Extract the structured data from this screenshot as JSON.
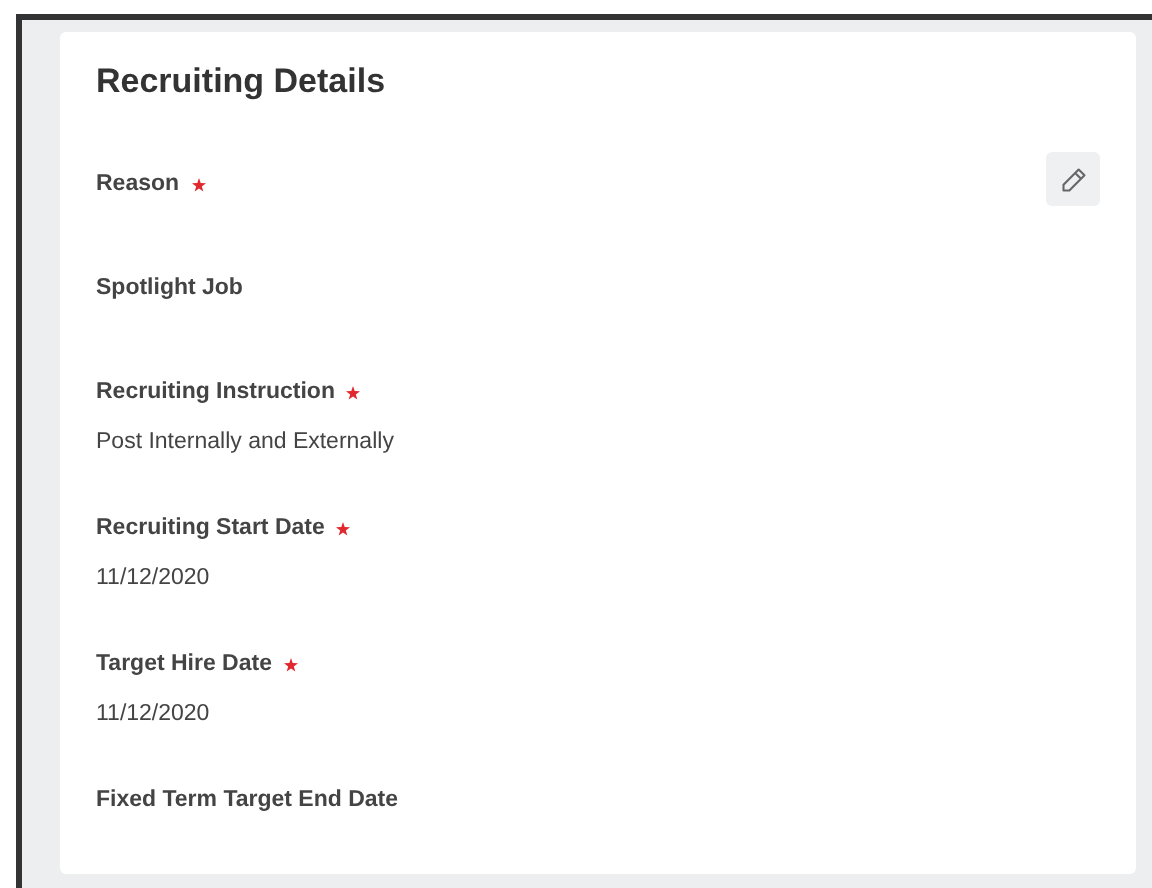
{
  "card": {
    "title": "Recruiting Details",
    "fields": [
      {
        "label": "Reason",
        "required": true
      },
      {
        "label": "Spotlight Job",
        "required": false
      },
      {
        "label": "Recruiting Instruction",
        "required": true,
        "value": "Post Internally and Externally"
      },
      {
        "label": "Recruiting Start Date",
        "required": true,
        "value": "11/12/2020"
      },
      {
        "label": "Target Hire Date",
        "required": true,
        "value": "11/12/2020"
      },
      {
        "label": "Fixed Term Target End Date",
        "required": false
      }
    ]
  }
}
